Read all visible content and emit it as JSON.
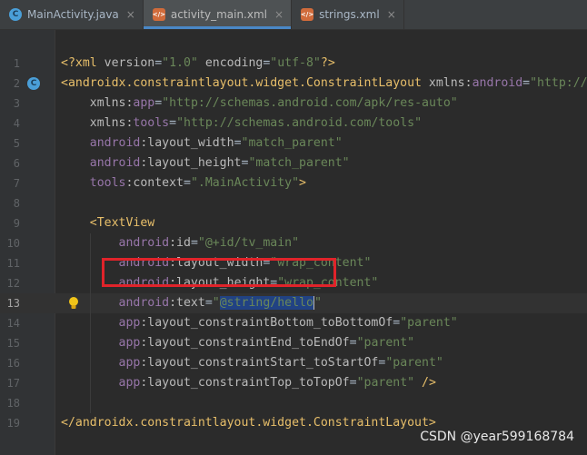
{
  "tabs": [
    {
      "label": "MainActivity.java",
      "type": "java",
      "active": false
    },
    {
      "label": "activity_main.xml",
      "type": "xml",
      "active": true
    },
    {
      "label": "strings.xml",
      "type": "xml",
      "active": false
    }
  ],
  "tab_close": "×",
  "lines": [
    {
      "num": "1",
      "tokens": [
        [
          "t",
          "<?xml "
        ],
        [
          "a",
          "version"
        ],
        [
          "p",
          "="
        ],
        [
          "v",
          "\"1.0\""
        ],
        [
          "a",
          " encoding"
        ],
        [
          "p",
          "="
        ],
        [
          "v",
          "\"utf-8\""
        ],
        [
          "t",
          "?>"
        ]
      ]
    },
    {
      "num": "2",
      "tokens": [
        [
          "t",
          "<androidx.constraintlayout.widget.ConstraintLayout "
        ],
        [
          "a",
          "xmlns:"
        ],
        [
          "n",
          "android"
        ],
        [
          "p",
          "="
        ],
        [
          "v",
          "\"http://"
        ]
      ]
    },
    {
      "num": "3",
      "tokens": [
        [
          "s",
          "    "
        ],
        [
          "a",
          "xmlns:"
        ],
        [
          "n",
          "app"
        ],
        [
          "p",
          "="
        ],
        [
          "v",
          "\"http://schemas.android.com/apk/res-auto\""
        ]
      ]
    },
    {
      "num": "4",
      "tokens": [
        [
          "s",
          "    "
        ],
        [
          "a",
          "xmlns:"
        ],
        [
          "n",
          "tools"
        ],
        [
          "p",
          "="
        ],
        [
          "v",
          "\"http://schemas.android.com/tools\""
        ]
      ]
    },
    {
      "num": "5",
      "tokens": [
        [
          "s",
          "    "
        ],
        [
          "n",
          "android"
        ],
        [
          "a",
          ":layout_width"
        ],
        [
          "p",
          "="
        ],
        [
          "v",
          "\"match_parent\""
        ]
      ]
    },
    {
      "num": "6",
      "tokens": [
        [
          "s",
          "    "
        ],
        [
          "n",
          "android"
        ],
        [
          "a",
          ":layout_height"
        ],
        [
          "p",
          "="
        ],
        [
          "v",
          "\"match_parent\""
        ]
      ]
    },
    {
      "num": "7",
      "tokens": [
        [
          "s",
          "    "
        ],
        [
          "n",
          "tools"
        ],
        [
          "a",
          ":context"
        ],
        [
          "p",
          "="
        ],
        [
          "v",
          "\".MainActivity\""
        ],
        [
          "t",
          ">"
        ]
      ]
    },
    {
      "num": "8",
      "tokens": []
    },
    {
      "num": "9",
      "tokens": [
        [
          "s",
          "    "
        ],
        [
          "t",
          "<TextView"
        ]
      ]
    },
    {
      "num": "10",
      "tokens": [
        [
          "s",
          "        "
        ],
        [
          "n",
          "android"
        ],
        [
          "a",
          ":id"
        ],
        [
          "p",
          "="
        ],
        [
          "v",
          "\"@+id/tv_main\""
        ]
      ]
    },
    {
      "num": "11",
      "tokens": [
        [
          "s",
          "        "
        ],
        [
          "n",
          "android"
        ],
        [
          "a",
          ":layout_width"
        ],
        [
          "p",
          "="
        ],
        [
          "v",
          "\"wrap_content\""
        ]
      ]
    },
    {
      "num": "12",
      "tokens": [
        [
          "s",
          "        "
        ],
        [
          "n",
          "android"
        ],
        [
          "a",
          ":layout_height"
        ],
        [
          "p",
          "="
        ],
        [
          "v",
          "\"wrap_content\""
        ]
      ]
    },
    {
      "num": "13",
      "current": true,
      "tokens": [
        [
          "s",
          "        "
        ],
        [
          "n",
          "android"
        ],
        [
          "a",
          ":text"
        ],
        [
          "p",
          "="
        ],
        [
          "v",
          "\""
        ],
        [
          "sel",
          "@string/hello"
        ],
        [
          "caret",
          ""
        ],
        [
          "v",
          "\""
        ]
      ]
    },
    {
      "num": "14",
      "tokens": [
        [
          "s",
          "        "
        ],
        [
          "n",
          "app"
        ],
        [
          "a",
          ":layout_constraintBottom_toBottomOf"
        ],
        [
          "p",
          "="
        ],
        [
          "v",
          "\"parent\""
        ]
      ]
    },
    {
      "num": "15",
      "tokens": [
        [
          "s",
          "        "
        ],
        [
          "n",
          "app"
        ],
        [
          "a",
          ":layout_constraintEnd_toEndOf"
        ],
        [
          "p",
          "="
        ],
        [
          "v",
          "\"parent\""
        ]
      ]
    },
    {
      "num": "16",
      "tokens": [
        [
          "s",
          "        "
        ],
        [
          "n",
          "app"
        ],
        [
          "a",
          ":layout_constraintStart_toStartOf"
        ],
        [
          "p",
          "="
        ],
        [
          "v",
          "\"parent\""
        ]
      ]
    },
    {
      "num": "17",
      "tokens": [
        [
          "s",
          "        "
        ],
        [
          "n",
          "app"
        ],
        [
          "a",
          ":layout_constraintTop_toTopOf"
        ],
        [
          "p",
          "="
        ],
        [
          "v",
          "\"parent\""
        ],
        [
          "t",
          " />"
        ]
      ]
    },
    {
      "num": "18",
      "tokens": []
    },
    {
      "num": "19",
      "tokens": [
        [
          "t",
          "</androidx.constraintlayout.widget.ConstraintLayout>"
        ]
      ]
    }
  ],
  "gutter_icons": {
    "line2": "C"
  },
  "watermark": "CSDN @year599168784",
  "colors": {
    "background": "#2b2b2b",
    "tag": "#e8bf6a",
    "namespace": "#9876aa",
    "value": "#6a8759",
    "highlight_box": "#e0232a"
  }
}
